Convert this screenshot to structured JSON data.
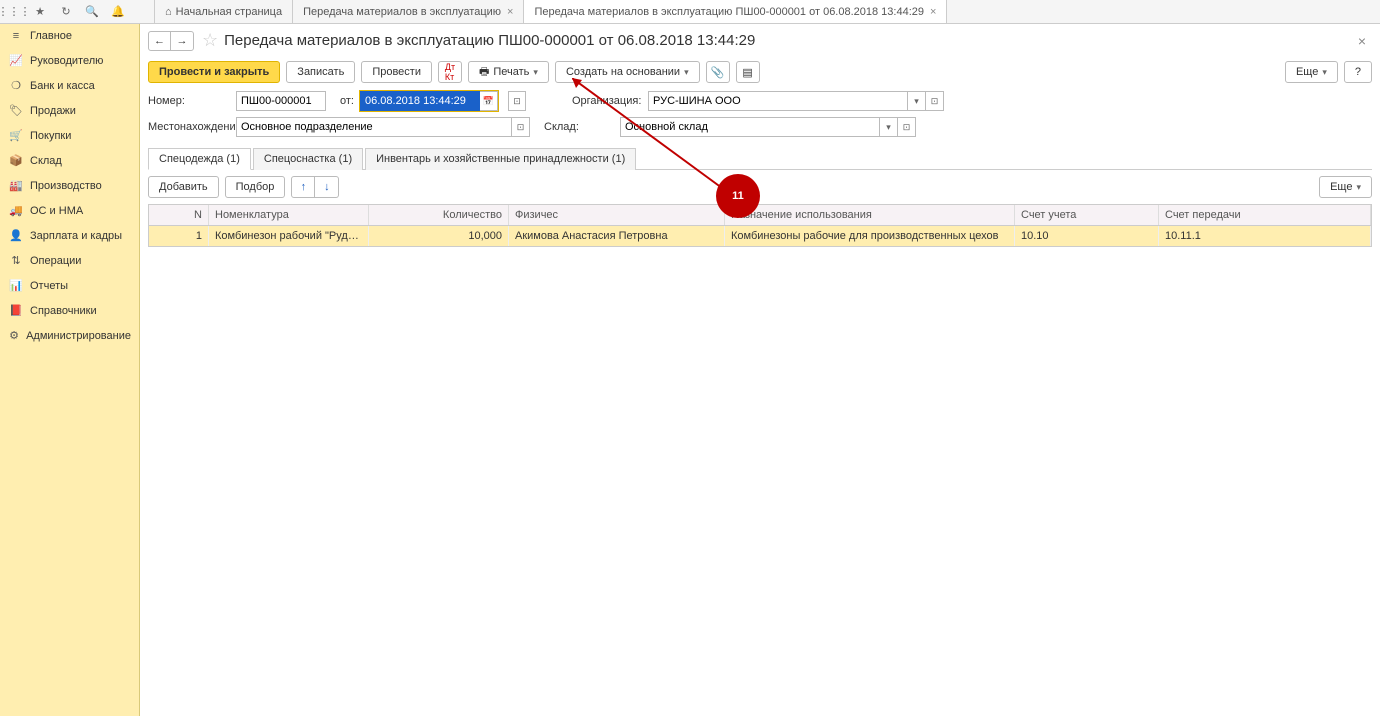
{
  "topbar": {
    "tabs": [
      {
        "label": "Начальная страница",
        "closable": false,
        "home": true
      },
      {
        "label": "Передача материалов в эксплуатацию",
        "closable": true
      },
      {
        "label": "Передача материалов в эксплуатацию ПШ00-000001 от 06.08.2018 13:44:29",
        "closable": true,
        "active": true
      }
    ]
  },
  "sidebar": {
    "items": [
      {
        "icon": "≡",
        "label": "Главное"
      },
      {
        "icon": "📈",
        "label": "Руководителю"
      },
      {
        "icon": "❍",
        "label": "Банк и касса"
      },
      {
        "icon": "🏷",
        "label": "Продажи"
      },
      {
        "icon": "🛒",
        "label": "Покупки"
      },
      {
        "icon": "📦",
        "label": "Склад"
      },
      {
        "icon": "🏭",
        "label": "Производство"
      },
      {
        "icon": "🚚",
        "label": "ОС и НМА"
      },
      {
        "icon": "👤",
        "label": "Зарплата и кадры"
      },
      {
        "icon": "⇅",
        "label": "Операции"
      },
      {
        "icon": "📊",
        "label": "Отчеты"
      },
      {
        "icon": "📕",
        "label": "Справочники"
      },
      {
        "icon": "⚙",
        "label": "Администрирование"
      }
    ]
  },
  "page": {
    "title": "Передача материалов в эксплуатацию ПШ00-000001 от 06.08.2018 13:44:29",
    "toolbar": {
      "post_close": "Провести и закрыть",
      "save": "Записать",
      "post": "Провести",
      "print": "Печать",
      "create_based": "Создать на основании",
      "more": "Еще",
      "help": "?"
    },
    "form": {
      "number_label": "Номер:",
      "number_value": "ПШ00-000001",
      "date_label": "от:",
      "date_value": "06.08.2018 13:44:29",
      "org_label": "Организация:",
      "org_value": "РУС-ШИНА ООО",
      "location_label": "Местонахождение:",
      "location_value": "Основное подразделение",
      "warehouse_label": "Склад:",
      "warehouse_value": "Основной склад"
    },
    "subtabs": [
      {
        "label": "Спецодежда (1)",
        "active": true
      },
      {
        "label": "Спецоснастка (1)"
      },
      {
        "label": "Инвентарь и хозяйственные принадлежности (1)"
      }
    ],
    "tabletoolbar": {
      "add": "Добавить",
      "select": "Подбор",
      "more": "Еще"
    },
    "table": {
      "headers": {
        "n": "N",
        "nom": "Номенклатура",
        "qty": "Количество",
        "phys": "Физичес",
        "purp": "Назначение использования",
        "acc": "Счет учета",
        "tacc": "Счет передачи"
      },
      "rows": [
        {
          "n": "1",
          "nom": "Комбинезон рабочий \"Рудокоп...",
          "qty": "10,000",
          "phys": "Акимова Анастасия Петровна",
          "purp": "Комбинезоны рабочие для производственных цехов",
          "acc": "10.10",
          "tacc": "10.11.1"
        }
      ]
    }
  },
  "annotation": {
    "number": "11"
  }
}
